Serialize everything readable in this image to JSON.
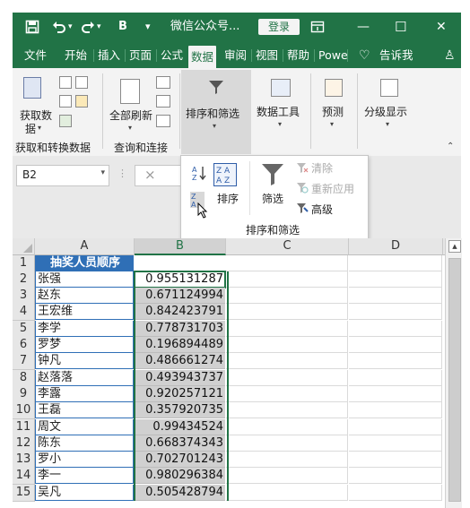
{
  "titlebar": {
    "save_icon": "save-icon",
    "undo_icon": "undo-icon",
    "redo_icon": "redo-icon",
    "bold_label": "B",
    "customize_icon": "customize-arrow-icon",
    "title": "微信公众号...",
    "login_label": "登录",
    "ribbon_display_icon": "ribbon-display-icon",
    "minimize_label": "—",
    "maximize_label": "☐",
    "close_label": "✕"
  },
  "tabs": [
    {
      "label": "文件"
    },
    {
      "label": "开始"
    },
    {
      "label": "插入"
    },
    {
      "label": "页面"
    },
    {
      "label": "公式"
    },
    {
      "label": "数据",
      "selected": true
    },
    {
      "label": "审阅"
    },
    {
      "label": "视图"
    },
    {
      "label": "帮助"
    },
    {
      "label": "Powe"
    },
    {
      "label": "告诉我"
    }
  ],
  "ribbon": {
    "get_data_line1": "获取数",
    "get_data_line2": "据",
    "refresh_all": "全部刷新",
    "group_get_transform": "获取和转换数据",
    "group_queries": "查询和连接",
    "sort_filter": "排序和筛选",
    "data_tools": "数据工具",
    "forecast": "预测",
    "outline": "分级显示"
  },
  "formula_bar": {
    "name_box": "B2",
    "cancel_symbol": "×"
  },
  "dropdown": {
    "sort_label": "排序",
    "filter_label": "筛选",
    "clear_label": "清除",
    "reapply_label": "重新应用",
    "advanced_label": "高级",
    "group_label": "排序和筛选"
  },
  "grid": {
    "columns": [
      "A",
      "B",
      "C",
      "D"
    ],
    "header_cell": "抽奖人员顺序",
    "rows": [
      {
        "num": "1"
      },
      {
        "num": "2",
        "name": "张强",
        "value": "0.955131287"
      },
      {
        "num": "3",
        "name": "赵东",
        "value": "0.671124994"
      },
      {
        "num": "4",
        "name": "王宏维",
        "value": "0.842423791"
      },
      {
        "num": "5",
        "name": "李学",
        "value": "0.778731703"
      },
      {
        "num": "6",
        "name": "罗梦",
        "value": "0.196894489"
      },
      {
        "num": "7",
        "name": "钟凡",
        "value": "0.486661274"
      },
      {
        "num": "8",
        "name": "赵落落",
        "value": "0.493943737"
      },
      {
        "num": "9",
        "name": "李露",
        "value": "0.920257121"
      },
      {
        "num": "10",
        "name": "王磊",
        "value": "0.357920735"
      },
      {
        "num": "11",
        "name": "周文",
        "value": "0.99434524"
      },
      {
        "num": "12",
        "name": "陈东",
        "value": "0.668374343"
      },
      {
        "num": "13",
        "name": "罗小",
        "value": "0.702701243"
      },
      {
        "num": "14",
        "name": "李一",
        "value": "0.980296384"
      },
      {
        "num": "15",
        "name": "吴凡",
        "value": "0.505428794"
      }
    ]
  },
  "colors": {
    "excel_green": "#217346",
    "table_border": "#2f6fb6",
    "header_fill": "#2f6fb6"
  }
}
